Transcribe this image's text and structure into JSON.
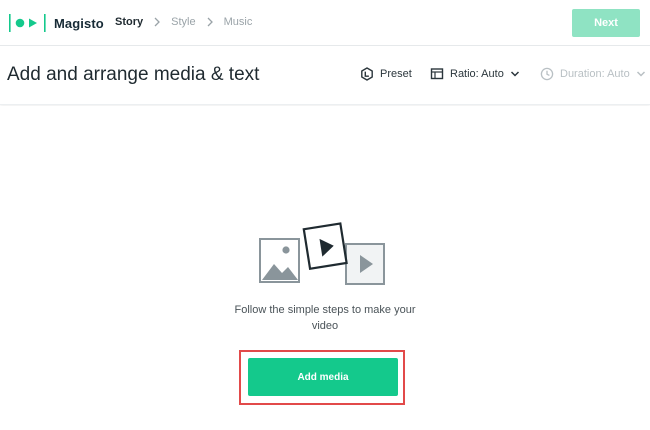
{
  "app": {
    "brand": "Magisto",
    "brand_color": "#14c98c"
  },
  "steps": [
    {
      "label": "Story",
      "active": true
    },
    {
      "label": "Style",
      "active": false
    },
    {
      "label": "Music",
      "active": false
    }
  ],
  "header": {
    "next_label": "Next",
    "next_enabled": false,
    "next_color": "#8fe3c3"
  },
  "titlebar": {
    "title": "Add and arrange media & text",
    "preset_label": "Preset",
    "preset_icon": "preset-icon",
    "ratio_label": "Ratio: Auto",
    "ratio_icon": "aspect-ratio-icon",
    "duration_label": "Duration: Auto",
    "duration_icon": "clock-icon",
    "duration_enabled": false
  },
  "main": {
    "empty_message": "Follow the simple steps to make your video",
    "add_media_label": "Add media",
    "add_media_color": "#14c98c",
    "highlight_color": "#e24a4a"
  }
}
